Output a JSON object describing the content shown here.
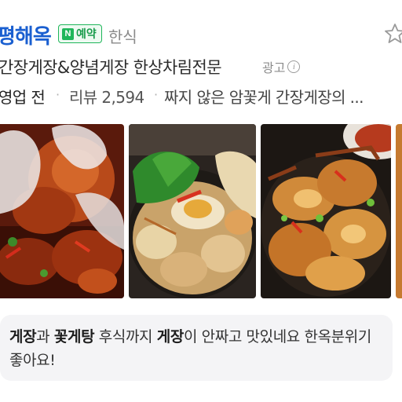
{
  "store": {
    "name": "평해옥",
    "booking_badge_letter": "N",
    "booking_badge": "예약",
    "category": "한식",
    "favorite_icon": "star-outline-icon"
  },
  "ad": {
    "description": "간장게장&양념게장 한상차림전문",
    "label": "광고",
    "info_icon": "info-icon"
  },
  "meta": {
    "status": "영업 전",
    "reviews": "리뷰 2,594",
    "snippet": "짜지 않은 암꽃게 간장게장의 ...",
    "separator": "·"
  },
  "photos": [
    {
      "subject": "seasoned-crab-gloved-hands"
    },
    {
      "subject": "crab-hotpot-with-greens"
    },
    {
      "subject": "soy-marinated-crab-plate"
    }
  ],
  "review": {
    "segments": [
      {
        "text": "게장",
        "bold": true
      },
      {
        "text": "과 ",
        "bold": false
      },
      {
        "text": "꽃게탕",
        "bold": true
      },
      {
        "text": " 후식까지 ",
        "bold": false
      },
      {
        "text": "게장",
        "bold": true
      },
      {
        "text": "이 안짜고 맛있네요 한옥분위기좋아요!",
        "bold": false
      }
    ]
  },
  "colors": {
    "brand_blue": "#1a5fd0",
    "naver_green": "#1fb65a",
    "review_bg": "#f4f4f6"
  }
}
